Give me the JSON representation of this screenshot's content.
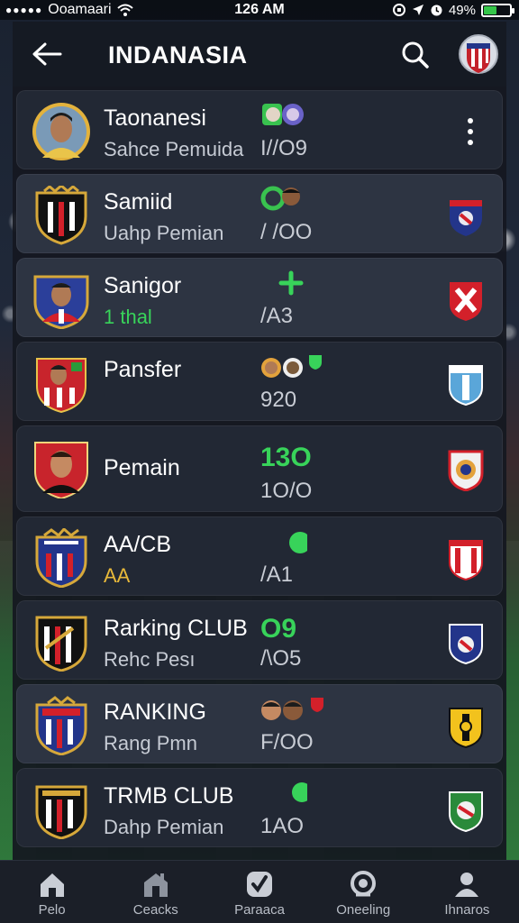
{
  "status": {
    "carrier": "Ooamaari",
    "time": "126 AM",
    "battery": "49%",
    "battery_level": 0.49
  },
  "header": {
    "title": "INDANASIA"
  },
  "rows": [
    {
      "name": "Taonanesi",
      "sub": "Sahce Pemuida",
      "value": "I//O9",
      "big": ""
    },
    {
      "name": "Samiid",
      "sub": "Uahp Pemian",
      "value": "/ /OO",
      "big": ""
    },
    {
      "name": "Sanigor",
      "sub": "1 thal",
      "value": "/A3",
      "big": ""
    },
    {
      "name": "Pansfer",
      "sub": "",
      "value": "920",
      "big": ""
    },
    {
      "name": "Pemain",
      "sub": "",
      "value": "1O/O",
      "big": "13O"
    },
    {
      "name": "AA/CB",
      "sub": "AA",
      "value": "/A1",
      "big": ""
    },
    {
      "name": "Rarking CLUB",
      "sub": "Rehc Pesı",
      "value": "/\\O5",
      "big": "O9"
    },
    {
      "name": "RANKING",
      "sub": "Rang Pmn",
      "value": "F/OO",
      "big": ""
    },
    {
      "name": "TRMB CLUB",
      "sub": "Dahp Pemian",
      "value": "1AO",
      "big": ""
    }
  ],
  "tabs": [
    {
      "label": "Pelo",
      "icon": "home-icon"
    },
    {
      "label": "Ceacks",
      "icon": "stadium-icon"
    },
    {
      "label": "Paraaca",
      "icon": "check-badge-icon"
    },
    {
      "label": "Oneeling",
      "icon": "target-icon"
    },
    {
      "label": "Ihnaros",
      "icon": "profile-icon"
    }
  ],
  "colors": {
    "accent_green": "#38d35a",
    "row_bg": "#222834",
    "row_highlight": "#2d3442",
    "red": "#d3202a",
    "navy": "#23358a"
  }
}
